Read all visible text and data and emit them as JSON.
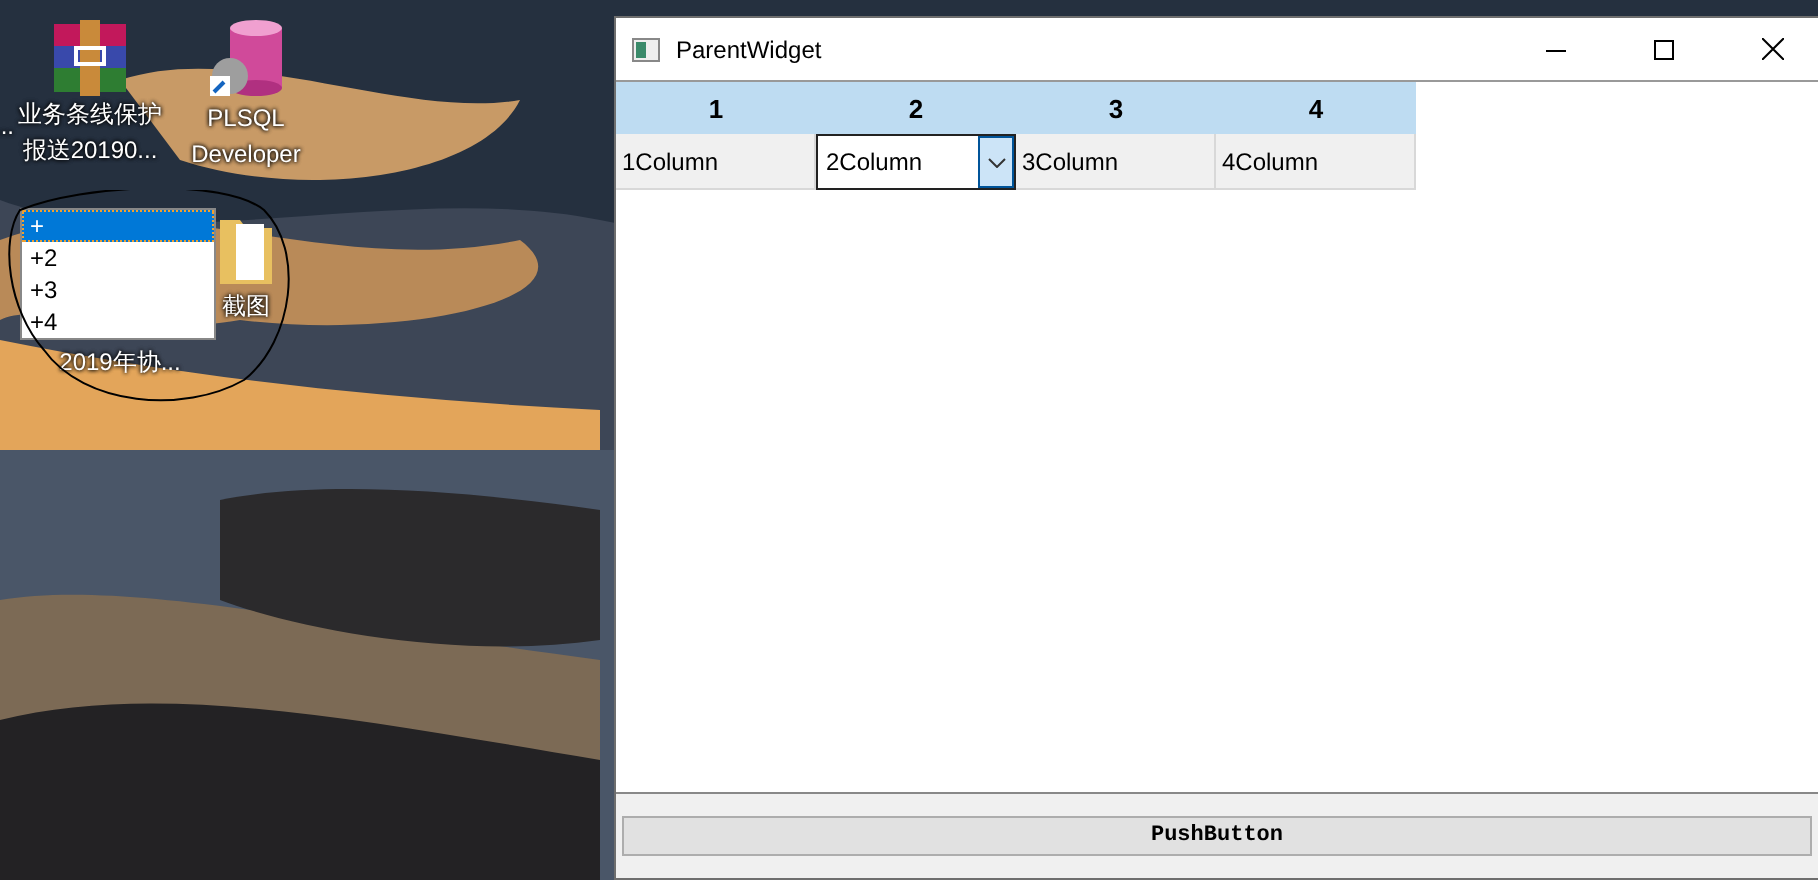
{
  "desktop": {
    "icons": [
      {
        "kind": "cut",
        "lines": [
          "..."
        ]
      },
      {
        "kind": "archive",
        "lines": [
          "业务条线保护",
          "报送20190..."
        ]
      },
      {
        "kind": "database",
        "lines": [
          "PLSQL",
          "Developer"
        ]
      },
      {
        "kind": "folder",
        "lines": [
          "截图"
        ]
      },
      {
        "kind": "hidden",
        "lines": [
          "2019年协..."
        ]
      }
    ]
  },
  "dropdown": {
    "items": [
      {
        "label": "+",
        "selected": true
      },
      {
        "label": "+2",
        "selected": false
      },
      {
        "label": "+3",
        "selected": false
      },
      {
        "label": "+4",
        "selected": false
      }
    ]
  },
  "window": {
    "title": "ParentWidget",
    "table": {
      "columns": [
        "1",
        "2",
        "3",
        "4"
      ],
      "rows": [
        {
          "cells": [
            {
              "kind": "text",
              "text": "1Column"
            },
            {
              "kind": "combo",
              "text": "2Column"
            },
            {
              "kind": "text",
              "text": "3Column"
            },
            {
              "kind": "text",
              "text": "4Column"
            }
          ]
        }
      ]
    },
    "button": "PushButton"
  }
}
